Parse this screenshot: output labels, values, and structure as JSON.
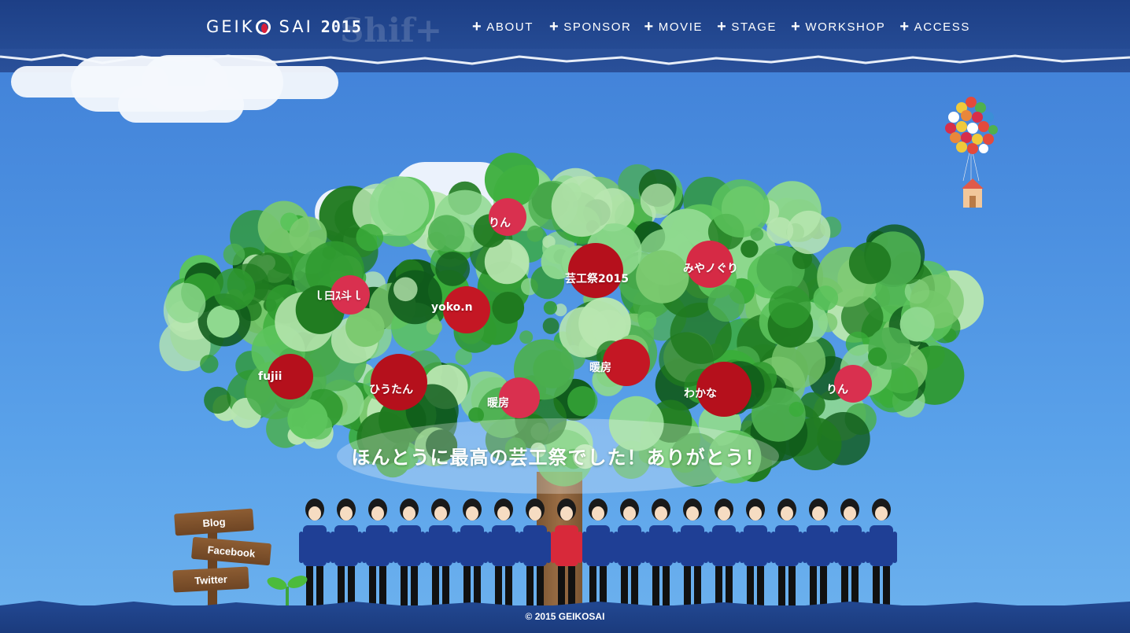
{
  "header": {
    "logo_text": "GEIK",
    "logo_text2": "SAI",
    "logo_year": "2015",
    "watermark": "Shif+",
    "nav": [
      {
        "label": "ABOUT"
      },
      {
        "label": "SPONSOR"
      },
      {
        "label": "MOVIE"
      },
      {
        "label": "STAGE"
      },
      {
        "label": "WORKSHOP"
      },
      {
        "label": "ACCESS"
      }
    ],
    "nav_plus": "+"
  },
  "tree": {
    "apples": [
      {
        "label": "りん",
        "color": "#d9304f"
      },
      {
        "label": "芸工祭2015",
        "color": "#b5101c"
      },
      {
        "label": "みやノぐり",
        "color": "#d62a45"
      },
      {
        "label": "ｌ曰ｽ斗ｌ",
        "color": "#d9304f"
      },
      {
        "label": "yoko.n",
        "color": "#c41724"
      },
      {
        "label": "暖房",
        "color": "#c41724"
      },
      {
        "label": "fujii",
        "color": "#b5101c"
      },
      {
        "label": "ひうたん",
        "color": "#b5101c"
      },
      {
        "label": "暖房",
        "color": "#d9304f"
      },
      {
        "label": "わかな",
        "color": "#b5101c"
      },
      {
        "label": "りん",
        "color": "#d9304f"
      }
    ],
    "message": "ほんとうに最高の芸工祭でした！ありがとう！"
  },
  "signpost": {
    "items": [
      {
        "label": "Blog"
      },
      {
        "label": "Facebook"
      },
      {
        "label": "Twitter"
      }
    ]
  },
  "footer": {
    "copyright": "© 2015 GEIKOSAI"
  },
  "colors": {
    "sky": "#4b8fe0",
    "header": "#254b94",
    "jacket": "#1f3f95",
    "apple_red": "#b5101c"
  }
}
